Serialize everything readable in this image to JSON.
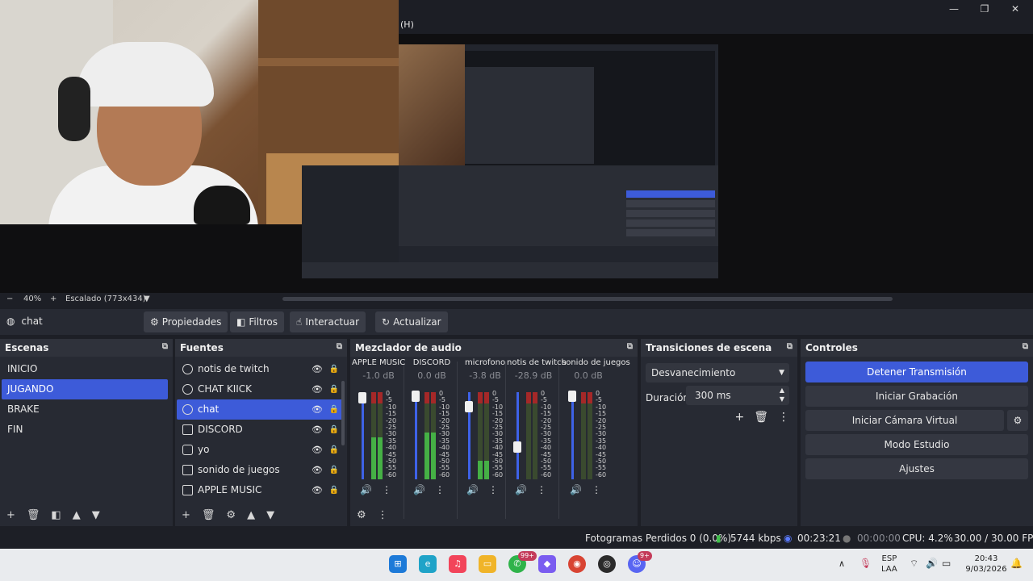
{
  "preview": {
    "menu_h": "(H)",
    "zoom": "40%",
    "zoom_minus": "−",
    "zoom_plus": "+",
    "scaling": "Escalado (773x434)",
    "window_controls": [
      "—",
      "❐",
      "✕"
    ]
  },
  "context_bar": {
    "source_name": "chat",
    "properties_label": "Propiedades",
    "filters_label": "Filtros",
    "interact_label": "Interactuar",
    "refresh_label": "Actualizar"
  },
  "scenes": {
    "title": "Escenas",
    "items": [
      "INICIO",
      "JUGANDO",
      "BRAKE",
      "FIN"
    ],
    "selected": "JUGANDO"
  },
  "sources": {
    "title": "Fuentes",
    "items": [
      {
        "label": "notis de twitch",
        "icon": "globe-icon"
      },
      {
        "label": "CHAT KIICK",
        "icon": "globe-icon"
      },
      {
        "label": "chat",
        "icon": "globe-icon",
        "selected": true
      },
      {
        "label": "DISCORD",
        "icon": "audio-capture-icon"
      },
      {
        "label": "yo",
        "icon": "camera-icon"
      },
      {
        "label": "sonido de juegos",
        "icon": "audio-capture-icon"
      },
      {
        "label": "APPLE MUSIC",
        "icon": "audio-capture-icon"
      }
    ]
  },
  "mixer": {
    "title": "Mezclador de audio",
    "scale": [
      "0",
      "-5",
      "-10",
      "-15",
      "-20",
      "-25",
      "-30",
      "-35",
      "-40",
      "-45",
      "-50",
      "-55",
      "-60"
    ],
    "channels": [
      {
        "name": "APPLE MUSIC",
        "db": "-1.0 dB",
        "volume": 0.98,
        "level": 0.55
      },
      {
        "name": "DISCORD",
        "db": "0.0 dB",
        "volume": 1.0,
        "level": 0.62
      },
      {
        "name": "microfono",
        "db": "-3.8 dB",
        "volume": 0.88,
        "level": 0.25
      },
      {
        "name": "notis de twitch",
        "db": "-28.9 dB",
        "volume": 0.42,
        "level": 0.0
      },
      {
        "name": "sonido de juegos",
        "db": "0.0 dB",
        "volume": 1.0,
        "level": 0.0
      }
    ]
  },
  "transitions": {
    "title": "Transiciones de escena",
    "selected": "Desvanecimiento",
    "duration_label": "Duración",
    "duration_value": "300 ms"
  },
  "controls": {
    "title": "Controles",
    "stop_stream": "Detener Transmisión",
    "start_recording": "Iniciar Grabación",
    "start_virtual_camera": "Iniciar Cámara Virtual",
    "studio_mode": "Modo Estudio",
    "settings": "Ajustes"
  },
  "status": {
    "dropped_frames": "Fotogramas Perdidos 0 (0.0%)",
    "bitrate": "5744 kbps",
    "stream_time": "00:23:21",
    "record_time": "00:00:00",
    "cpu": "CPU: 4.2%",
    "fps": "30.00 / 30.00 FPS"
  },
  "taskbar": {
    "whatsapp_badge": "99+",
    "discord_badge": "9+",
    "language_line1": "ESP",
    "language_line2": "LAA",
    "time": "20:43",
    "date": "9/03/2026"
  },
  "colors": {
    "accent": "#3d5bd9",
    "panel": "#272a33",
    "background": "#1d1f26",
    "meter_green": "#45b045",
    "meter_red": "#a52828",
    "stream_green": "#3fbf4a"
  }
}
